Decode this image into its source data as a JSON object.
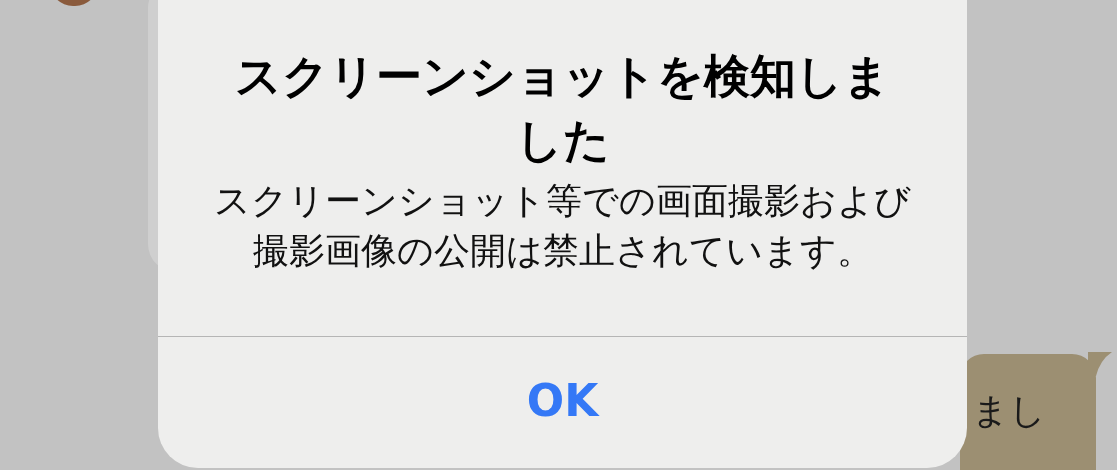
{
  "chat": {
    "messages": [
      {
        "kind": "received"
      },
      {
        "kind": "sent",
        "text": "まし"
      }
    ]
  },
  "alert": {
    "title": "スクリーンショットを検知しました",
    "message": "スクリーンショット等での画面撮影および撮影画像の公開は禁止されています。",
    "buttons": [
      {
        "label": "OK"
      }
    ]
  }
}
